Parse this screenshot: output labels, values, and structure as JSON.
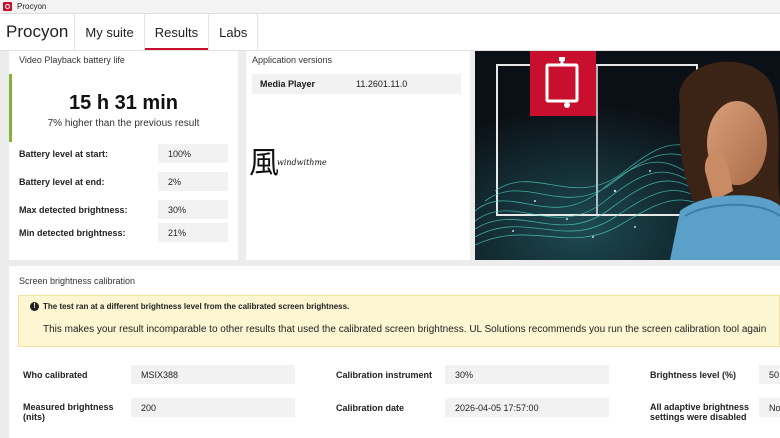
{
  "window": {
    "title": "Procyon"
  },
  "nav": {
    "brand": "Procyon",
    "tabs": [
      {
        "label": "My suite",
        "active": false
      },
      {
        "label": "Results",
        "active": true
      },
      {
        "label": "Labs",
        "active": false
      }
    ]
  },
  "battery": {
    "heading": "Video Playback battery life",
    "result": "15 h 31 min",
    "comparison": "7% higher than the previous result",
    "rows": [
      {
        "label": "Battery level at start:",
        "value": "100%"
      },
      {
        "label": "Battery level at end:",
        "value": "2%"
      },
      {
        "label": "Max detected brightness:",
        "value": "30%"
      },
      {
        "label": "Min detected brightness:",
        "value": "21%"
      }
    ]
  },
  "versions": {
    "heading": "Application versions",
    "rows": [
      {
        "label": "Media Player",
        "value": "11.2601.11.0"
      }
    ],
    "watermark": {
      "glyph": "風",
      "text": "windwithme"
    }
  },
  "calibration": {
    "heading": "Screen brightness calibration",
    "warning_title": "The test ran at a different brightness level from the calibrated screen brightness.",
    "warning_body": "This makes your result incomparable to other results that used the calibrated screen brightness. UL Solutions recommends you run the screen calibration tool again",
    "fields": [
      {
        "label": "Who calibrated",
        "value": "MSIX388"
      },
      {
        "label": "Calibration instrument",
        "value": "30%"
      },
      {
        "label": "Brightness level (%)",
        "value": "50"
      },
      {
        "label": "Measured brightness (nits)",
        "value": "200"
      },
      {
        "label": "Calibration date",
        "value": "2026-04-05 17:57:00"
      },
      {
        "label": "All adaptive brightness settings were disabled",
        "value": "No"
      }
    ]
  },
  "colors": {
    "accent": "#c8102e",
    "positive": "#84b135",
    "warning_bg": "#fcf6d3"
  }
}
